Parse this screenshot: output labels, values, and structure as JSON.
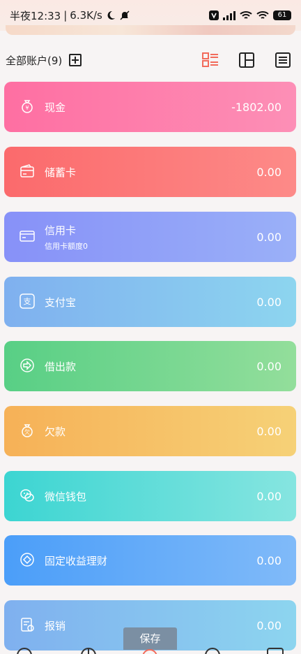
{
  "status": {
    "time": "半夜12:33",
    "speed": "6.3K/s",
    "battery": "61"
  },
  "header": {
    "title": "全部账户(9)"
  },
  "accounts": [
    {
      "name": "现金",
      "sub": "",
      "amount": "-1802.00",
      "icon": "money-bag-icon",
      "colors": [
        "#fe6fa2",
        "#fd8fb6"
      ]
    },
    {
      "name": "储蓄卡",
      "sub": "",
      "amount": "0.00",
      "icon": "wallet-icon",
      "colors": [
        "#fb6a6c",
        "#fd8a88"
      ]
    },
    {
      "name": "信用卡",
      "sub": "信用卡额度0",
      "amount": "0.00",
      "icon": "credit-card-icon",
      "colors": [
        "#8791f8",
        "#9ab0f8"
      ]
    },
    {
      "name": "支付宝",
      "sub": "",
      "amount": "0.00",
      "icon": "alipay-icon",
      "colors": [
        "#7fb0ef",
        "#8dd5ef"
      ]
    },
    {
      "name": "借出款",
      "sub": "",
      "amount": "0.00",
      "icon": "lend-icon",
      "colors": [
        "#58cf85",
        "#93de9b"
      ]
    },
    {
      "name": "欠款",
      "sub": "",
      "amount": "0.00",
      "icon": "debt-bag-icon",
      "colors": [
        "#f6b157",
        "#f6d177"
      ]
    },
    {
      "name": "微信钱包",
      "sub": "",
      "amount": "0.00",
      "icon": "wechat-icon",
      "colors": [
        "#3cd5d2",
        "#86e5e0"
      ]
    },
    {
      "name": "固定收益理财",
      "sub": "",
      "amount": "0.00",
      "icon": "diamond-icon",
      "colors": [
        "#4b9ef9",
        "#80baf9"
      ]
    },
    {
      "name": "报销",
      "sub": "",
      "amount": "0.00",
      "icon": "reimburse-icon",
      "colors": [
        "#7fb0ef",
        "#8dd5ef"
      ]
    }
  ],
  "save_label": "保存"
}
